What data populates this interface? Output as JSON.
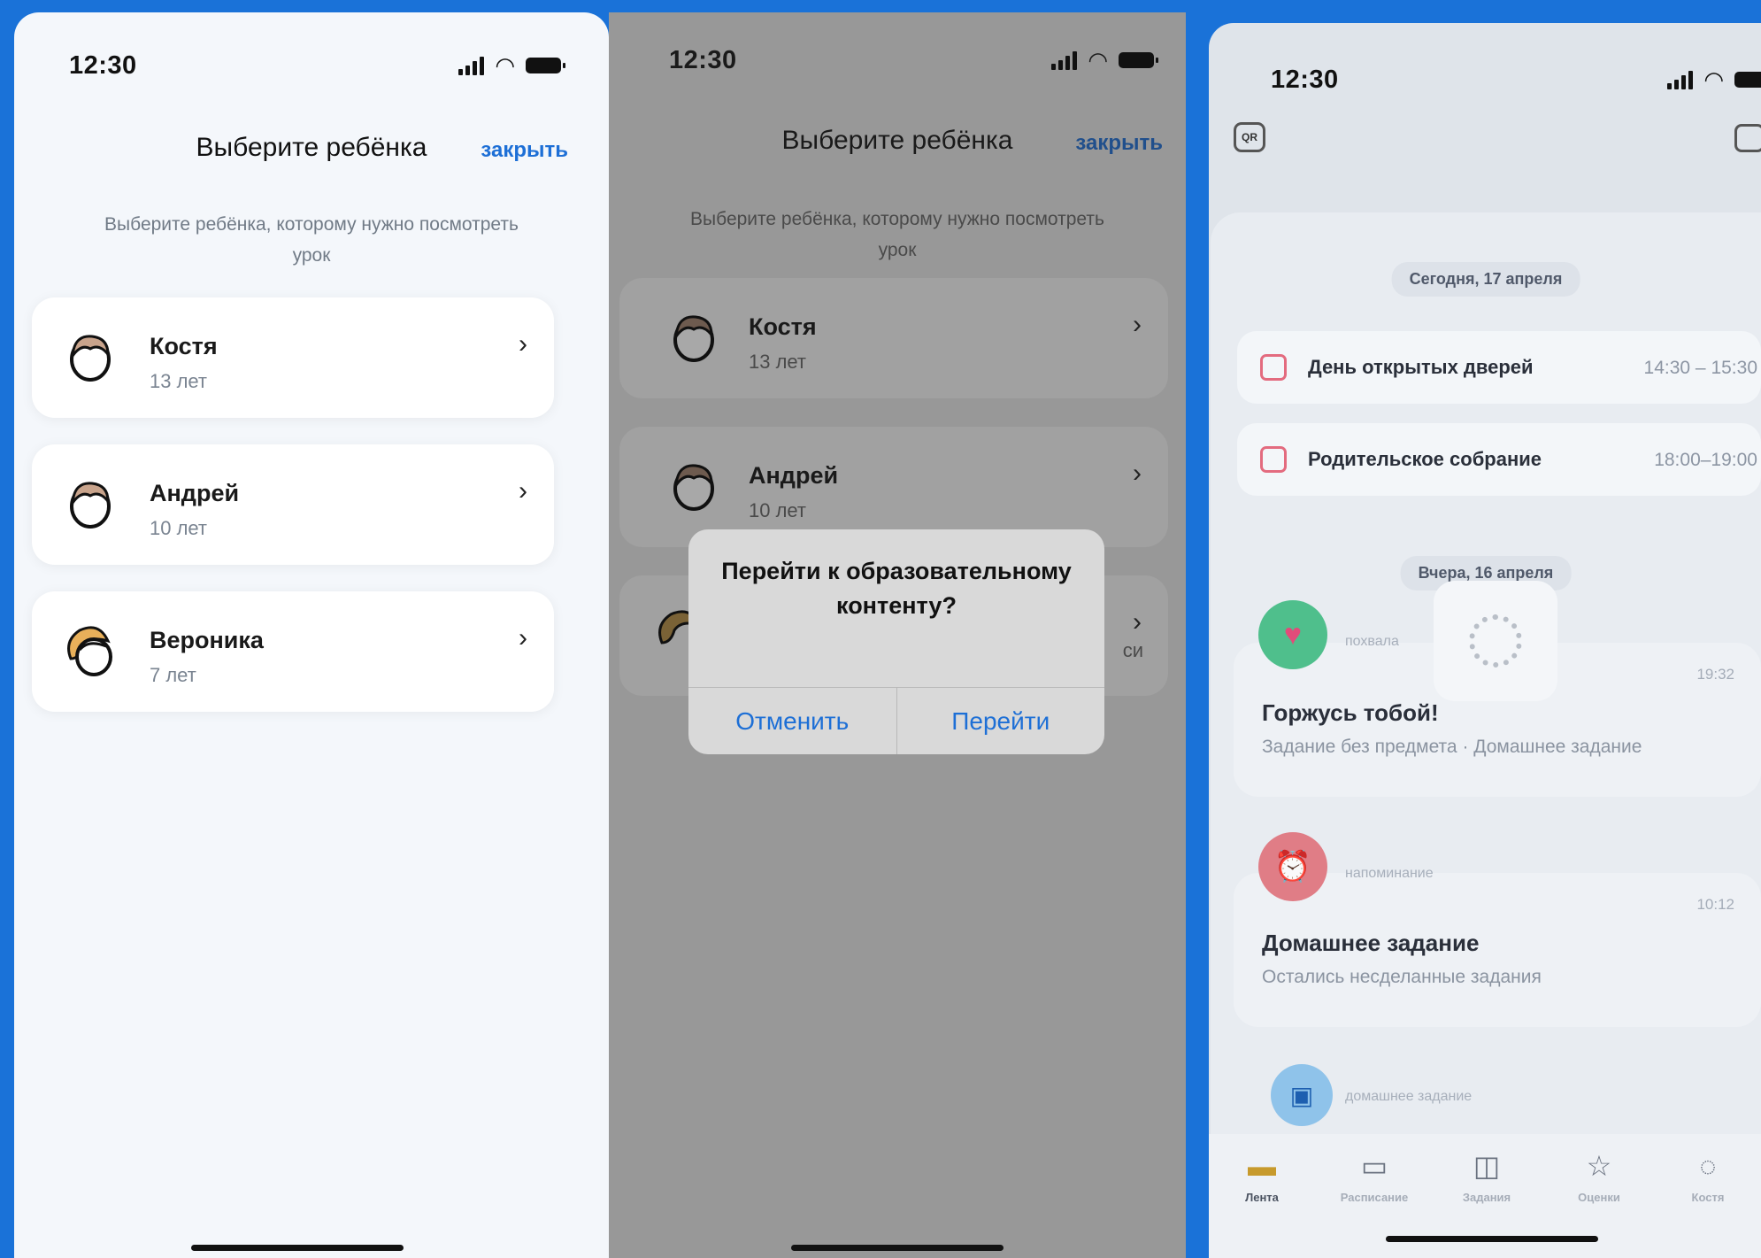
{
  "status_time": "12:30",
  "select_child": {
    "title": "Выберите ребёнка",
    "close": "закрыть",
    "subtitle": "Выберите ребёнка, которому нужно посмотреть урок",
    "children": [
      {
        "name": "Костя",
        "age": "13 лет",
        "avatar": "boy-avatar"
      },
      {
        "name": "Андрей",
        "age": "10 лет",
        "avatar": "boy-avatar"
      },
      {
        "name": "Вероника",
        "age": "7 лет",
        "avatar": "girl-avatar"
      }
    ]
  },
  "dialog": {
    "title": "Перейти к образовательному контенту?",
    "cancel": "Отменить",
    "confirm": "Перейти",
    "behind_fragment": "си"
  },
  "feed": {
    "today": "Сегодня, 17 апреля",
    "events": [
      {
        "name": "День открытых дверей ",
        "time": "14:30 – 15:30"
      },
      {
        "name": "Родительское собрание",
        "time": "18:00–19:00"
      }
    ],
    "yesterday": "Вчера, 16 апреля",
    "notifications": [
      {
        "label": "похвала",
        "time": "19:32",
        "title": "Горжусь тобой!",
        "text": "Задание без предмета · Домашнее задание"
      },
      {
        "label": "напоминание",
        "time": "10:12",
        "title": "Домашнее задание",
        "text": "Остались несделанные задания"
      }
    ],
    "third_label": "домашнее задание",
    "qr_label": "QR"
  },
  "tabbar": [
    {
      "label": "Лента",
      "icon": "feed-icon",
      "glyph": "▬"
    },
    {
      "label": "Расписание",
      "icon": "calendar-icon",
      "glyph": "▭"
    },
    {
      "label": "Задания",
      "icon": "book-icon",
      "glyph": "◫"
    },
    {
      "label": "Оценки",
      "icon": "star-icon",
      "glyph": "☆"
    },
    {
      "label": "Костя",
      "icon": "child-avatar-icon",
      "glyph": "◌"
    }
  ],
  "colors": {
    "accent": "#1d6fd6",
    "background": "#1a72d8",
    "calendar": "#e36b7f"
  }
}
